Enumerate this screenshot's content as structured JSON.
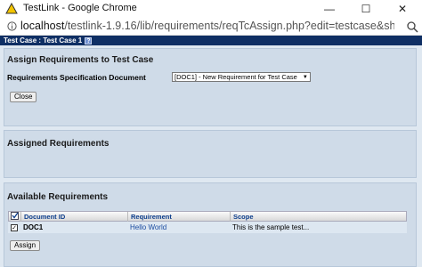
{
  "window": {
    "title": "TestLink - Google Chrome",
    "min_glyph": "—",
    "max_glyph": "☐",
    "close_glyph": "✕"
  },
  "address": {
    "host": "localhost",
    "path": "/testlink-1.9.16/lib/requirements/reqTcAssign.php?edit=testcase&sh..."
  },
  "page_header": {
    "label": "Test Case : Test Case 1",
    "help_glyph": "?"
  },
  "assign_panel": {
    "title": "Assign Requirements to Test Case",
    "spec_label": "Requirements Specification Document",
    "spec_selected": "[DOC1] - New Requirement for Test Case",
    "close_label": "Close"
  },
  "assigned_panel": {
    "title": "Assigned Requirements"
  },
  "available_panel": {
    "title": "Available Requirements",
    "columns": [
      "Document ID",
      "Requirement",
      "Scope"
    ],
    "rows": [
      {
        "doc_id": "DOC1",
        "requirement": "Hello World",
        "scope": "This is the sample test...",
        "checked": true
      }
    ],
    "assign_label": "Assign"
  },
  "colors": {
    "header_bg": "#0f2f64",
    "panel_bg": "#cfdbe8",
    "link": "#1b4ca0"
  }
}
